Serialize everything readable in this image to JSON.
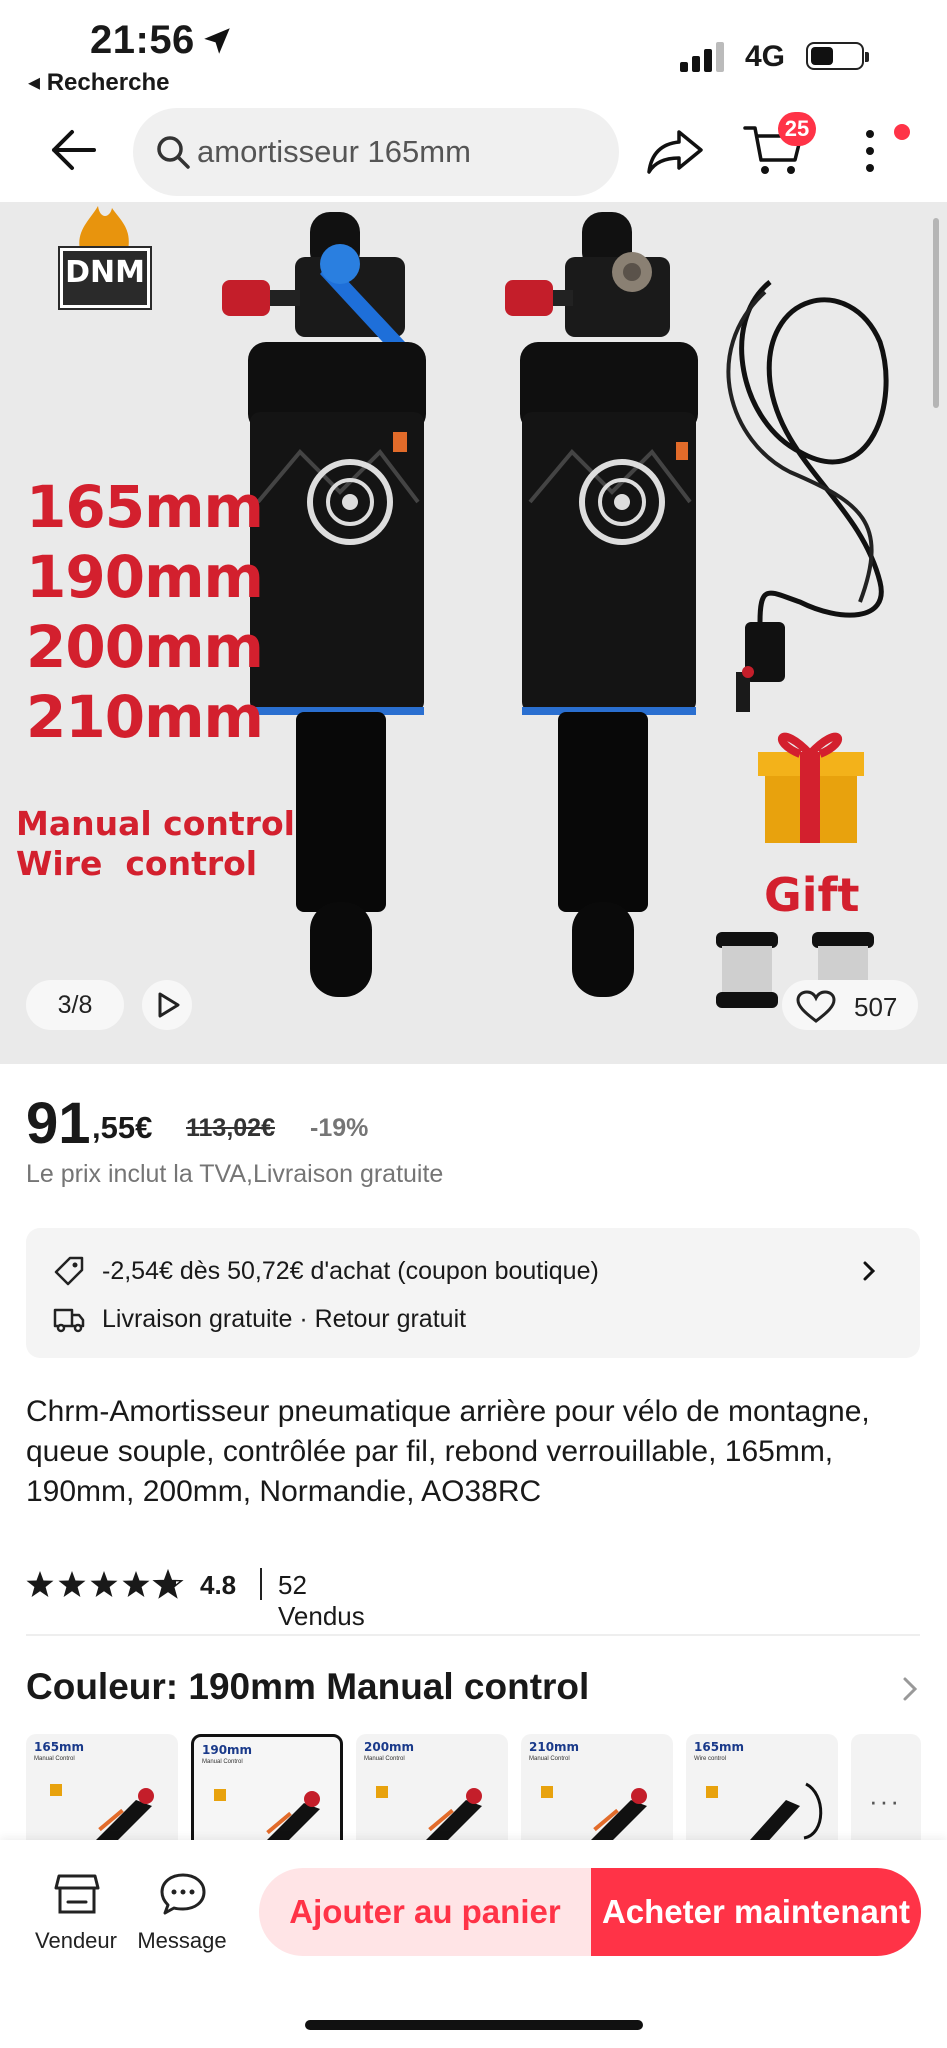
{
  "status_bar": {
    "time": "21:56",
    "back_app": "◂ Recherche",
    "network": "4G"
  },
  "nav": {
    "search_query": "amortisseur 165mm",
    "cart_count": "25"
  },
  "gallery": {
    "sizes": [
      "165mm",
      "190mm",
      "200mm",
      "210mm"
    ],
    "controls": [
      "Manual control",
      "Wire  control"
    ],
    "gift_label": "Gift",
    "brand_logo": "DNM",
    "counter": "3/8",
    "likes": "507"
  },
  "price": {
    "integer": "91",
    "decimal": ",55€",
    "original": "113,02€",
    "discount": "-19%",
    "note": "Le prix inclut la TVA,Livraison gratuite"
  },
  "info_card": {
    "coupon": "-2,54€ dès 50,72€ d'achat (coupon boutique)",
    "shipping": "Livraison gratuite · Retour gratuit"
  },
  "product": {
    "title": "Chrm-Amortisseur pneumatique arrière pour vélo de montagne, queue souple, contrôlée par fil, rebond verrouillable, 165mm, 190mm, 200mm, Normandie, AO38RC",
    "rating": "4.8",
    "sold": "52 Vendus"
  },
  "color": {
    "label": "Couleur: 190mm Manual control",
    "options": [
      {
        "size": "165mm",
        "type": "Manual Control",
        "selected": false
      },
      {
        "size": "190mm",
        "type": "Manual Control",
        "selected": true
      },
      {
        "size": "200mm",
        "type": "Manual Control",
        "selected": false
      },
      {
        "size": "210mm",
        "type": "Manual Control",
        "selected": false
      },
      {
        "size": "165mm",
        "type": "Wire control",
        "selected": false
      }
    ],
    "more": "···"
  },
  "bottom_bar": {
    "vendor_label": "Vendeur",
    "message_label": "Message",
    "add_to_cart": "Ajouter au panier",
    "buy_now": "Acheter maintenant"
  },
  "colors": {
    "accent": "#ff3347",
    "accent_light": "#ffe4e6",
    "gallery_bg": "#eaeaea",
    "promo_red": "#d3202e"
  }
}
